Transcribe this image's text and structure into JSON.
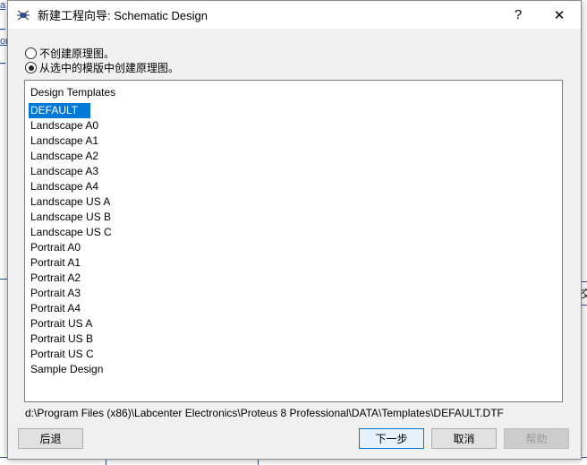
{
  "dialog": {
    "title": "新建工程向导: Schematic Design",
    "help_label": "?",
    "close_label": "✕",
    "options": [
      {
        "label": "不创建原理图。",
        "selected": false
      },
      {
        "label": "从选中的模版中创建原理图。",
        "selected": true
      }
    ],
    "list": {
      "header": "Design Templates",
      "items": [
        "DEFAULT",
        "Landscape A0",
        "Landscape A1",
        "Landscape A2",
        "Landscape A3",
        "Landscape A4",
        "Landscape US A",
        "Landscape US B",
        "Landscape US C",
        "Portrait A0",
        "Portrait A1",
        "Portrait A2",
        "Portrait A3",
        "Portrait A4",
        "Portrait US A",
        "Portrait US B",
        "Portrait US C",
        "Sample Design"
      ],
      "selected": "DEFAULT"
    },
    "path": "d:\\Program Files (x86)\\Labcenter Electronics\\Proteus 8 Professional\\DATA\\Templates\\DEFAULT.DTF",
    "buttons": {
      "back": "后退",
      "next": "下一步",
      "cancel": "取消",
      "help": "帮助"
    }
  },
  "background": {
    "right_text": "交"
  },
  "colors": {
    "selection": "#0078d7",
    "dialog_bg": "#f0f0f0"
  }
}
